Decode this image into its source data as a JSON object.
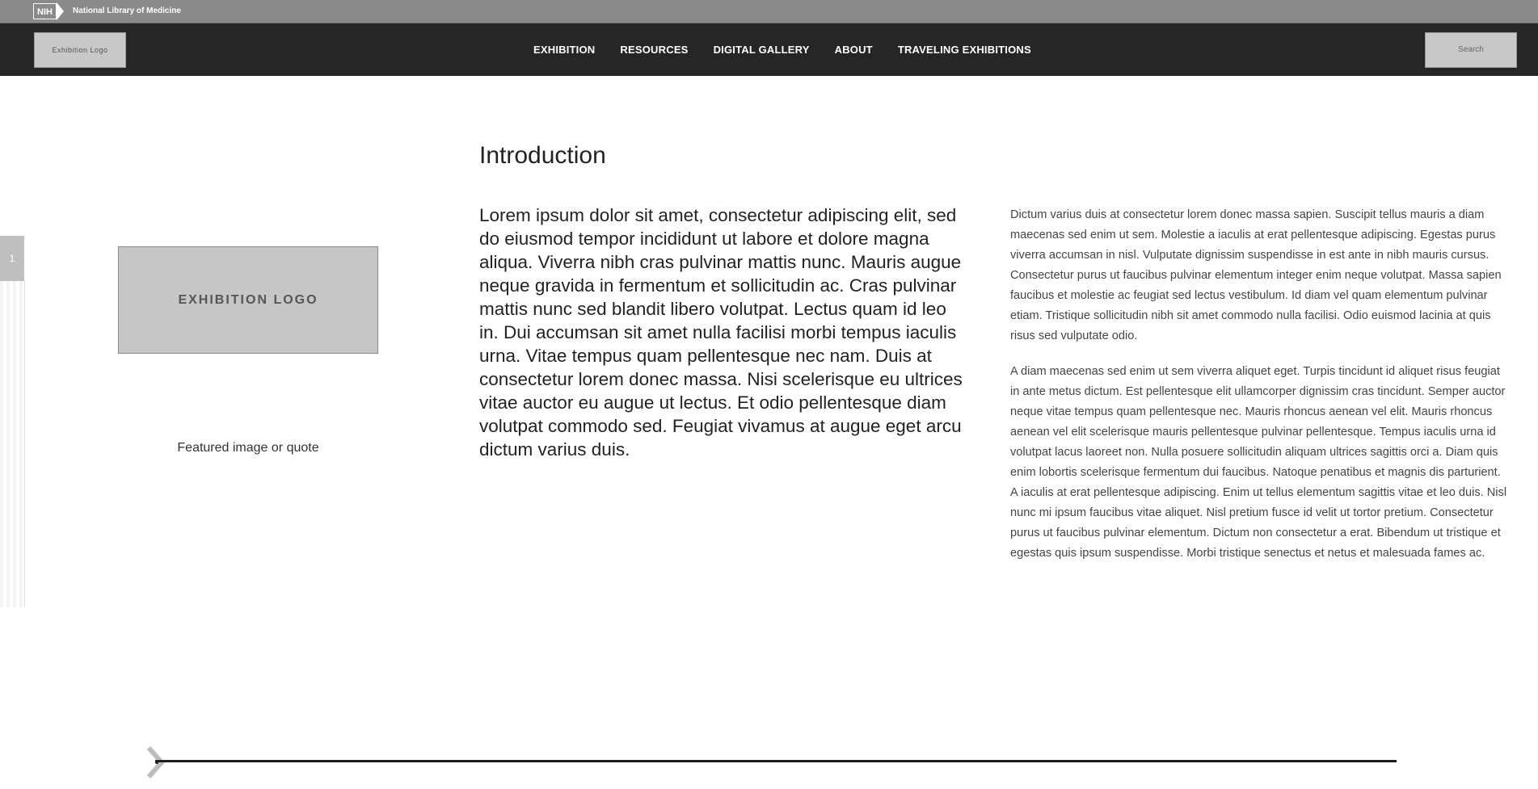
{
  "topbar": {
    "nih_label": "NIH",
    "nlm_label": "National Library of Medicine"
  },
  "nav": {
    "logo_label": "Exhibition Logo",
    "items": [
      "EXHIBITION",
      "RESOURCES",
      "DIGITAL GALLERY",
      "ABOUT",
      "TRAVELING EXHIBITIONS"
    ],
    "search_label": "Search"
  },
  "side_tab": {
    "label": "1"
  },
  "left": {
    "logo_label": "EXHIBITION LOGO",
    "featured_label": "Featured image or quote"
  },
  "main": {
    "title": "Introduction",
    "intro": "Lorem ipsum dolor sit amet, consectetur adipiscing elit, sed do eiusmod tempor incididunt ut labore et dolore magna aliqua. Viverra nibh cras pulvinar mattis nunc. Mauris augue neque gravida in fermentum et sollicitudin ac. Cras pulvinar mattis nunc sed blandit libero volutpat. Lectus quam id leo in. Dui accumsan sit amet nulla facilisi morbi tempus iaculis urna. Vitae tempus quam pellentesque nec nam. Duis at consectetur lorem donec massa. Nisi scelerisque eu ultrices vitae auctor eu augue ut lectus. Et odio pellentesque diam volutpat commodo sed. Feugiat vivamus at augue eget arcu dictum varius duis."
  },
  "right": {
    "paragraphs": [
      "Dictum varius duis at consectetur lorem donec massa sapien. Suscipit tellus mauris a diam maecenas sed enim ut sem. Molestie a iaculis at erat pellentesque adipiscing. Egestas purus viverra accumsan in nisl. Vulputate dignissim suspendisse in est ante in nibh mauris cursus. Consectetur purus ut faucibus pulvinar elementum integer enim neque volutpat. Massa sapien faucibus et molestie ac feugiat sed lectus vestibulum. Id diam vel quam elementum pulvinar etiam. Tristique sollicitudin nibh sit amet commodo nulla facilisi. Odio euismod lacinia at quis risus sed vulputate odio.",
      "A diam maecenas sed enim ut sem viverra aliquet eget. Turpis tincidunt id aliquet risus feugiat in ante metus dictum. Est pellentesque elit ullamcorper dignissim cras tincidunt. Semper auctor neque vitae tempus quam pellentesque nec. Mauris rhoncus aenean vel elit. Mauris rhoncus aenean vel elit scelerisque mauris pellentesque pulvinar pellentesque. Tempus iaculis urna id volutpat lacus laoreet non. Nulla posuere sollicitudin aliquam ultrices sagittis orci a. Diam quis enim lobortis scelerisque fermentum dui faucibus. Natoque penatibus et magnis dis parturient. A iaculis at erat pellentesque adipiscing. Enim ut tellus elementum sagittis vitae et leo duis. Nisl nunc mi ipsum faucibus vitae aliquet. Nisl pretium fusce id velit ut tortor pretium. Consectetur purus ut faucibus pulvinar elementum. Dictum non consectetur a erat. Bibendum ut tristique et egestas quis ipsum suspendisse. Morbi tristique senectus et netus et malesuada fames ac."
    ]
  },
  "timeline": {
    "icon": "chevron-right-icon",
    "color": "#1e1e1e"
  },
  "colors": {
    "topbar": "#8a8a8a",
    "navbar": "#262626",
    "placeholder": "#c6c6c6"
  }
}
